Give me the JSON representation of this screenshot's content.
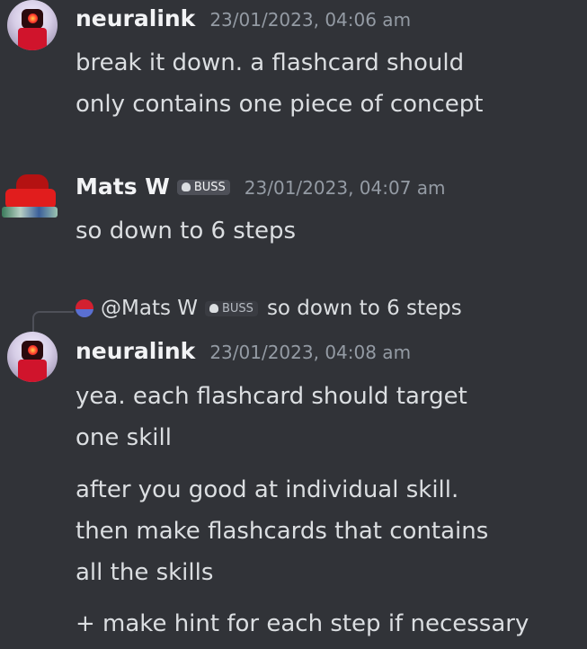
{
  "messages": [
    {
      "author": "neuralink",
      "timestamp": "23/01/2023, 04:06 am",
      "lines": [
        "break it down. a flashcard should",
        "only contains one piece of concept"
      ]
    },
    {
      "author": "Mats W",
      "tag": "BUSS",
      "timestamp": "23/01/2023, 04:07 am",
      "lines": [
        "so down to 6 steps"
      ]
    },
    {
      "reply": {
        "mention": "@Mats W",
        "tag": "BUSS",
        "text": "so down to 6 steps"
      },
      "author": "neuralink",
      "timestamp": "23/01/2023, 04:08 am",
      "paragraphs": [
        [
          "yea. each flashcard should target",
          "one skill"
        ],
        [
          "after you good at individual skill.",
          "then make flashcards that contains",
          "all the skills"
        ],
        [
          "+ make hint for each step if necessary"
        ]
      ]
    }
  ],
  "icons": {
    "neuralink_avatar": "robot-avatar-icon",
    "mats_avatar": "red-robot-avatar-icon",
    "tag_icon": "skull-icon",
    "reply_avatar": "reply-avatar-icon"
  }
}
